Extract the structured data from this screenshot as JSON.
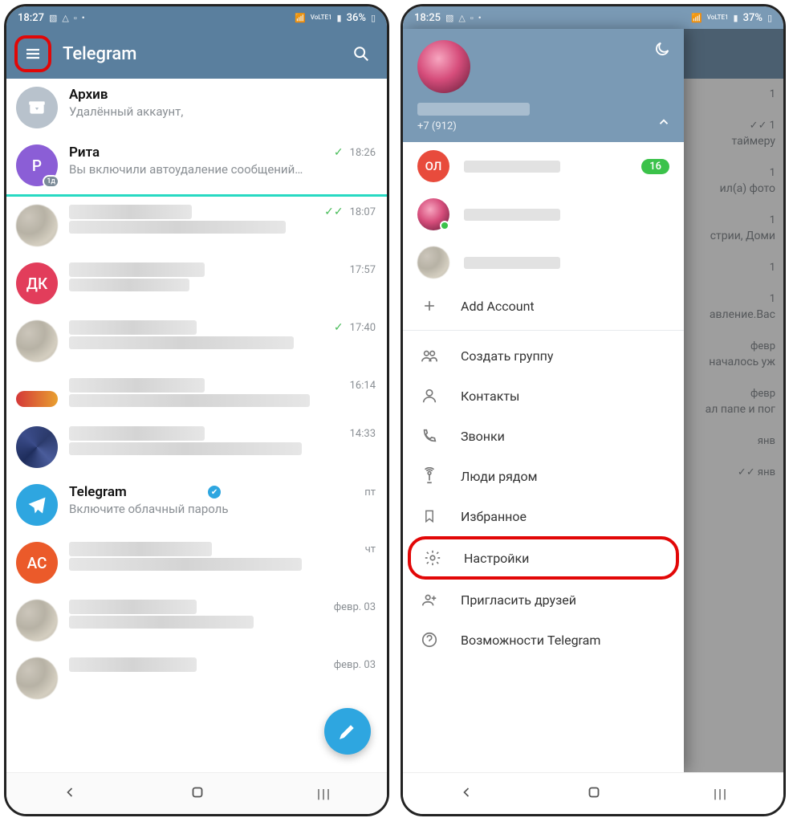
{
  "left": {
    "status": {
      "time": "18:27",
      "battery": "36%"
    },
    "header": {
      "title": "Telegram"
    },
    "chats": [
      {
        "avatar": "archive",
        "name": "Архив",
        "msg": "Удалённый аккаунт,",
        "time": "",
        "checks": ""
      },
      {
        "avatar": "letter",
        "letter": "Р",
        "color": "#8b5ed6",
        "name": "Рита",
        "msg": "Вы включили автоудаление сообщений…",
        "time": "18:26",
        "checks": "single",
        "badge1d": true,
        "underline": true
      },
      {
        "avatar": "blur",
        "name_blur_w": "220",
        "msg_blur_w": "270",
        "time": "18:07",
        "checks": "double"
      },
      {
        "avatar": "letter",
        "letter": "ДК",
        "color": "#e23d5b",
        "name_blur_w": "160",
        "msg_blur_w": "150",
        "time": "17:57",
        "checks": ""
      },
      {
        "avatar": "blur",
        "name_blur_w": "130",
        "msg_blur_w": "280",
        "time": "17:40",
        "checks": "single"
      },
      {
        "avatar": "pill",
        "name_blur_w": "140",
        "msg_blur_w": "300",
        "time": "16:14",
        "checks": ""
      },
      {
        "avatar": "blur2",
        "name_blur_w": "100",
        "msg_blur_w": "290",
        "time": "14:33",
        "checks": ""
      },
      {
        "avatar": "telegram",
        "name": "Telegram",
        "verified": true,
        "msg": "Включите облачный пароль",
        "time": "пт",
        "checks": ""
      },
      {
        "avatar": "letter",
        "letter": "АС",
        "color": "#eb5a2a",
        "name_blur_w": "110",
        "msg_blur_w": "290",
        "time": "чт",
        "checks": ""
      },
      {
        "avatar": "blur",
        "name_blur_w": "140",
        "msg_blur_w": "230",
        "time": "февр. 03",
        "checks": ""
      },
      {
        "avatar": "blur",
        "name_blur_w": "190",
        "msg_blur_w": "0",
        "time": "февр. 03",
        "checks": ""
      }
    ]
  },
  "right": {
    "status": {
      "time": "18:25",
      "battery": "37%"
    },
    "drawer": {
      "phone": "+7 (912)",
      "accounts": [
        {
          "letter": "ОЛ",
          "color": "#e84b3c",
          "badge": "16"
        },
        {
          "avatar": "pink",
          "online": true
        },
        {
          "avatar": "blur"
        }
      ],
      "add_account": "Add Account",
      "menu": [
        {
          "icon": "group",
          "label": "Создать группу"
        },
        {
          "icon": "user",
          "label": "Контакты"
        },
        {
          "icon": "phone",
          "label": "Звонки"
        },
        {
          "icon": "nearby",
          "label": "Люди рядом"
        },
        {
          "icon": "bookmark",
          "label": "Избранное"
        },
        {
          "icon": "gear",
          "label": "Настройки",
          "highlight": true
        },
        {
          "icon": "invite",
          "label": "Пригласить друзей"
        },
        {
          "icon": "help",
          "label": "Возможности Telegram"
        }
      ]
    },
    "bg_rows": [
      {
        "time": "1",
        "txt": ""
      },
      {
        "time": "✓✓ 1",
        "txt": "таймеру"
      },
      {
        "time": "1",
        "txt": "ил(а) фото"
      },
      {
        "time": "1",
        "txt": "стрии, Доми"
      },
      {
        "time": "1",
        "txt": ""
      },
      {
        "time": "1",
        "txt": "авление.Вас"
      },
      {
        "time": "февр",
        "txt": "началось уж"
      },
      {
        "time": "февр",
        "txt": "ал папе и пог"
      },
      {
        "time": "янв",
        "txt": ""
      },
      {
        "time": "✓✓ янв",
        "txt": ""
      }
    ]
  }
}
